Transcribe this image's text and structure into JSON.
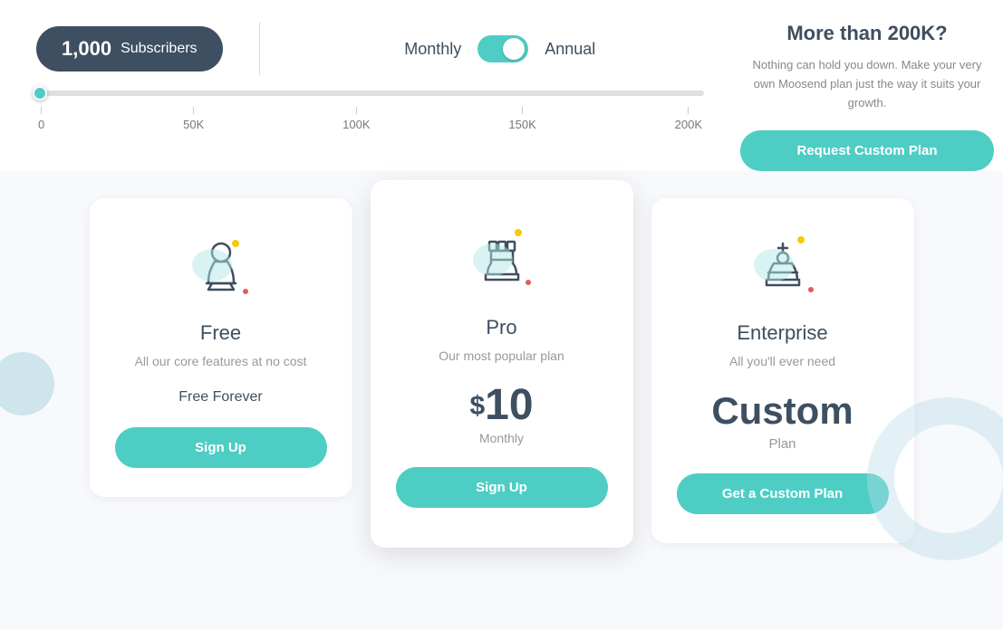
{
  "header": {
    "subscribers_count": "1,000",
    "subscribers_label": "Subscribers",
    "billing_monthly": "Monthly",
    "billing_annual": "Annual",
    "custom_headline": "More than 200K?",
    "custom_desc": "Nothing can hold you down. Make your very own Moosend plan just the way it suits your growth.",
    "custom_btn": "Request Custom Plan"
  },
  "slider": {
    "ticks": [
      "0",
      "50K",
      "100K",
      "150K",
      "200K"
    ]
  },
  "plans": [
    {
      "name": "Free",
      "desc": "All our core features at no cost",
      "price_type": "free",
      "price_label": "Free Forever",
      "btn": "Sign Up"
    },
    {
      "name": "Pro",
      "desc": "Our most popular plan",
      "price_type": "paid",
      "price_dollar": "$",
      "price_amount": "10",
      "price_period": "Monthly",
      "btn": "Sign Up",
      "featured": true
    },
    {
      "name": "Enterprise",
      "desc": "All you'll ever need",
      "price_type": "custom",
      "price_label": "Custom",
      "price_sub": "Plan",
      "btn": "Get a Custom Plan"
    }
  ]
}
